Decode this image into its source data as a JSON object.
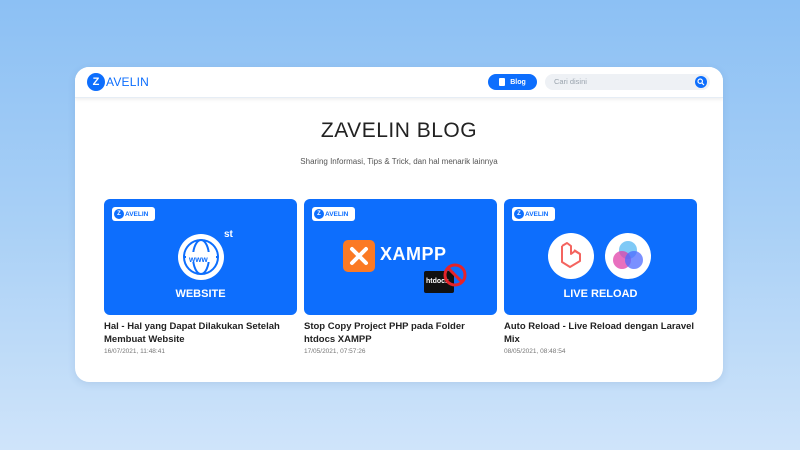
{
  "brand": {
    "mark": "Z",
    "text": "AVELIN"
  },
  "nav": {
    "blog_label": "Blog",
    "search_placeholder": "Cari disini"
  },
  "hero": {
    "title": "ZAVELIN BLOG",
    "subtitle": "Sharing Informasi, Tips & Trick, dan hal menarik lainnya"
  },
  "badge": {
    "mark": "Z",
    "text": "AVELIN"
  },
  "posts": [
    {
      "thumb_caption": "WEBSITE",
      "thumb_extra": "st",
      "icon": "www-globe-icon",
      "title": "Hal - Hal yang Dapat Dilakukan Setelah Membuat Website",
      "date": "16/07/2021, 11:48:41"
    },
    {
      "thumb_caption": "XAMPP",
      "thumb_extra": "htdocs",
      "icon": "xampp-logo-icon",
      "title": "Stop Copy Project PHP pada Folder htdocs XAMPP",
      "date": "17/05/2021, 07:57:26"
    },
    {
      "thumb_caption": "LIVE RELOAD",
      "icon": "laravel-mix-logos-icon",
      "title": "Auto Reload - Live Reload dengan Laravel Mix",
      "date": "08/05/2021, 08:48:54"
    }
  ],
  "colors": {
    "accent": "#0d6efd",
    "background": "#a9d0f6"
  }
}
